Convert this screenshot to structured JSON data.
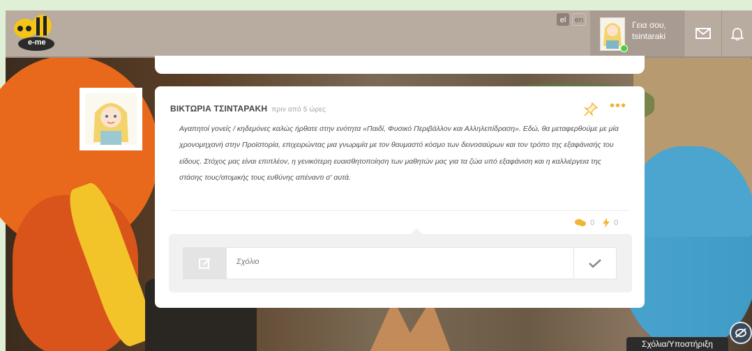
{
  "header": {
    "logo_text": "e-me",
    "languages": [
      {
        "code": "el",
        "active": true
      },
      {
        "code": "en",
        "active": false
      }
    ],
    "greeting_line1": "Γεια σου,",
    "greeting_line2": "tsintaraki"
  },
  "post": {
    "author": "ΒΙΚΤΩΡΙΑ ΤΣΙΝΤΑΡΑΚΗ",
    "time_ago": "πριν από 5 ώρες",
    "text": "Αγαπητοί γονείς / κηδεμόνες καλώς ήρθατε στην ενότητα «Παιδί, Φυσικό Περιβάλλον και Αλληλεπίδραση». Εδώ, θα μεταφερθούμε με μία χρονομηχανή στην Προϊστορία, επιχειρώντας μια γνωριμία με τον θαυμαστό κόσμο των δεινοσαύρων και τον τρόπο της εξαφάνισής του είδους. Στόχος μας είναι επιπλέον, η γενικότερη ευαισθητοποίηση των μαθητών μας για τα ζώα υπό εξαφάνιση και η καλλιέργεια της στάσης τους/ατομικής τους ευθύνης απέναντι σ' αυτά.",
    "comments_count": "0",
    "likes_count": "0",
    "comment_placeholder": "Σχόλιο"
  },
  "feedback": {
    "label": "Σχόλια/Υποστήριξη"
  },
  "colors": {
    "header_bg": "#b8aba0",
    "accent_yellow": "#f2b437",
    "page_bg": "#dff0d6"
  }
}
